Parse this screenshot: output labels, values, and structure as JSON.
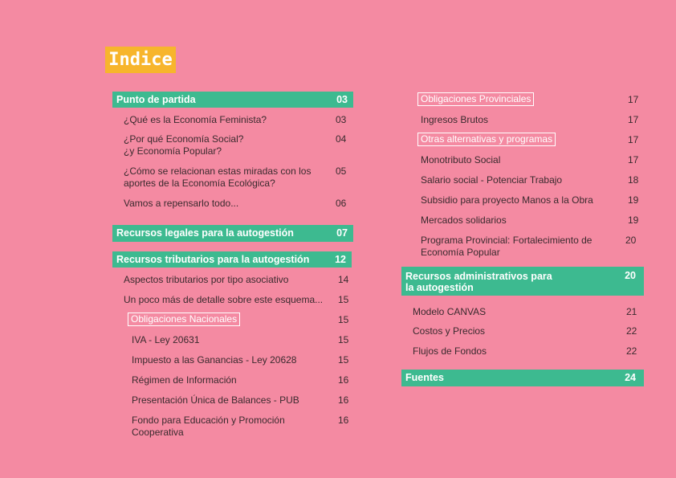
{
  "title": "Indice",
  "left": {
    "s1": {
      "label": "Punto de partida",
      "page": "03"
    },
    "s1_items": [
      {
        "text": "¿Qué es la Economía Feminista?",
        "page": "03"
      },
      {
        "text": "¿Por qué Economía Social?\n¿y Economía Popular?",
        "page": "04"
      },
      {
        "text": "¿Cómo se relacionan estas miradas con los\naportes de la Economía Ecológica?",
        "page": "05"
      },
      {
        "text": "Vamos a repensarlo todo...",
        "page": "06"
      }
    ],
    "s2": {
      "label": "Recursos legales para la autogestión",
      "page": "07"
    },
    "s3": {
      "label": "Recursos tributarios para la autogestión",
      "page": "12"
    },
    "s3_items": [
      {
        "text": "Aspectos tributarios por tipo asociativo",
        "page": "14"
      },
      {
        "text": "Un poco más de detalle sobre este esquema...",
        "page": "15"
      }
    ],
    "nacionales": {
      "label": "Obligaciones Nacionales",
      "page": "15"
    },
    "nac_items": [
      {
        "text": "IVA - Ley 20631",
        "page": "15"
      },
      {
        "text": "Impuesto a las Ganancias - Ley 20628",
        "page": "15"
      },
      {
        "text": "Régimen de Información",
        "page": "16"
      },
      {
        "text": "Presentación Única de Balances - PUB",
        "page": "16"
      },
      {
        "text": "Fondo para Educación y Promoción\nCooperativa",
        "page": "16"
      }
    ]
  },
  "right": {
    "provinciales": {
      "label": "Obligaciones Provinciales",
      "page": "17"
    },
    "ingresos": {
      "text": "Ingresos Brutos",
      "page": "17"
    },
    "otras": {
      "label": "Otras alternativas y programas",
      "page": "17"
    },
    "otras_items": [
      {
        "text": "Monotributo Social",
        "page": "17"
      },
      {
        "text": "Salario social - Potenciar Trabajo",
        "page": "18"
      },
      {
        "text": "Subsidio para proyecto Manos a la Obra",
        "page": "19"
      },
      {
        "text": "Mercados solidarios",
        "page": "19"
      },
      {
        "text": "Programa Provincial: Fortalecimiento de\nEconomía Popular",
        "page": "20"
      }
    ],
    "s4": {
      "label": "Recursos administrativos para\nla autogestión",
      "page": "20"
    },
    "s4_items": [
      {
        "text": "Modelo CANVAS",
        "page": "21"
      },
      {
        "text": "Costos y Precios",
        "page": "22"
      },
      {
        "text": "Flujos de Fondos",
        "page": "22"
      }
    ],
    "s5": {
      "label": "Fuentes",
      "page": "24"
    }
  }
}
